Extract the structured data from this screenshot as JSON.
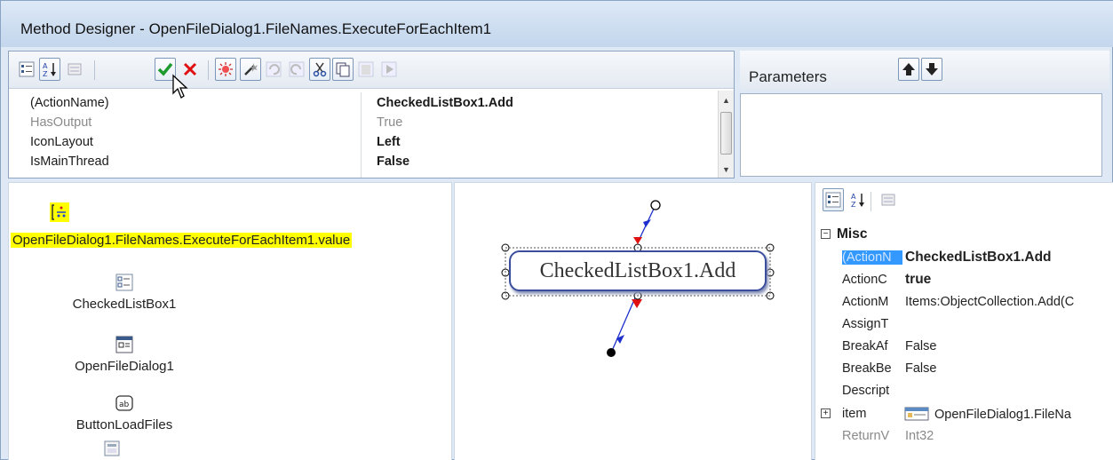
{
  "window": {
    "title": "Method Designer - OpenFileDialog1.FileNames.ExecuteForEachItem1"
  },
  "toolbar": {
    "buttons": [
      "categorized-icon",
      "alphabetical-icon",
      "property-pages-icon",
      "ok-check-icon",
      "cancel-x-icon",
      "debug-icon",
      "magic-wand-icon",
      "undo-icon",
      "redo-icon",
      "cut-icon",
      "copy-icon",
      "paste-icon",
      "run-icon"
    ]
  },
  "property_grid": {
    "rows": [
      {
        "name": "(ActionName)",
        "value": "CheckedListBox1.Add",
        "bold": true,
        "dim": false
      },
      {
        "name": "HasOutput",
        "value": "True",
        "bold": false,
        "dim": true
      },
      {
        "name": "IconLayout",
        "value": "Left",
        "bold": true,
        "dim": false
      },
      {
        "name": "IsMainThread",
        "value": "False",
        "bold": true,
        "dim": false
      }
    ]
  },
  "parameters": {
    "label": "Parameters"
  },
  "components": {
    "highlighted": "OpenFileDialog1.FileNames.ExecuteForEachItem1.value",
    "items": [
      {
        "label": "CheckedListBox1",
        "icon": "checked-listbox-icon"
      },
      {
        "label": "OpenFileDialog1",
        "icon": "open-file-dialog-icon"
      },
      {
        "label": "ButtonLoadFiles",
        "icon": "button-icon"
      }
    ]
  },
  "canvas": {
    "node_label": "CheckedListBox1.Add"
  },
  "properties": {
    "category": "Misc",
    "rows": [
      {
        "name": "(ActionN",
        "value": "CheckedListBox1.Add",
        "bold": true,
        "selected": true,
        "dim": false
      },
      {
        "name": "ActionC",
        "value": "true",
        "bold": true,
        "selected": false,
        "dim": false
      },
      {
        "name": "ActionM",
        "value": "Items:ObjectCollection.Add(C",
        "bold": false,
        "selected": false,
        "dim": false
      },
      {
        "name": "AssignT",
        "value": "",
        "bold": false,
        "selected": false,
        "dim": false
      },
      {
        "name": "BreakAf",
        "value": "False",
        "bold": false,
        "selected": false,
        "dim": false
      },
      {
        "name": "BreakBe",
        "value": "False",
        "bold": false,
        "selected": false,
        "dim": false
      },
      {
        "name": "Descript",
        "value": "",
        "bold": false,
        "selected": false,
        "dim": false
      },
      {
        "name": "item",
        "value": "OpenFileDialog1.FileNa",
        "bold": false,
        "selected": false,
        "dim": false,
        "expandable": true
      },
      {
        "name": "ReturnV",
        "value": "Int32",
        "bold": false,
        "selected": false,
        "dim": true
      }
    ]
  },
  "colors": {
    "highlight": "#ffff00",
    "selection": "#3399ff",
    "node_border": "#3b4e9e",
    "accent_red": "#e01010"
  }
}
